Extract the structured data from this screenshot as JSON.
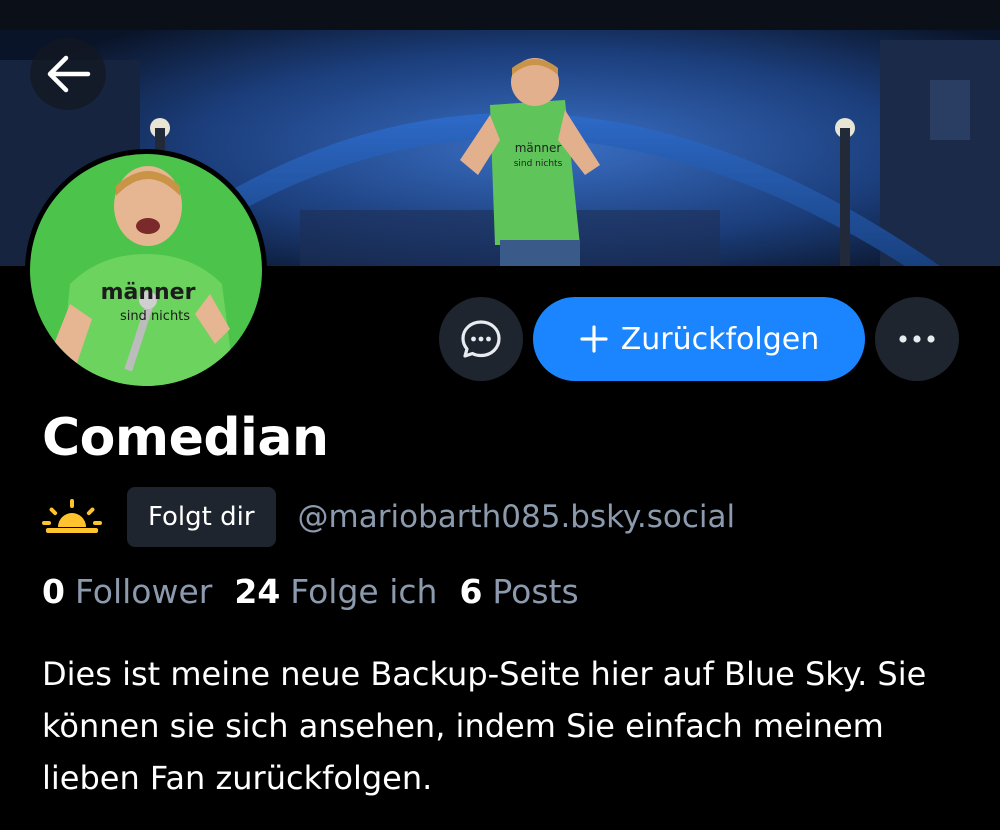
{
  "profile": {
    "display_name": "Comedian",
    "handle": "@mariobarth085.bsky.social",
    "follows_you_label": "Folgt dir",
    "bio": "Dies ist meine neue Backup-Seite hier auf Blue Sky. Sie können sie sich ansehen, indem Sie einfach meinem lieben Fan zurückfolgen.",
    "avatar_shirt_text": [
      "männer",
      "sind nichts"
    ],
    "banner_shirt_text": [
      "männer",
      "sind nichts"
    ]
  },
  "stats": [
    {
      "count": "0",
      "label": "Follower"
    },
    {
      "count": "24",
      "label": "Folge ich"
    },
    {
      "count": "6",
      "label": "Posts"
    }
  ],
  "actions": {
    "follow_back_label": "Zurückfolgen",
    "message_icon": "chat-bubble-icon",
    "more_icon": "ellipsis-icon",
    "back_icon": "arrow-left-icon"
  },
  "colors": {
    "accent": "#1a85ff",
    "background": "#000000",
    "muted_text": "#8c9aae",
    "button_dark": "#1e252e",
    "sun": "#ffc32e"
  }
}
